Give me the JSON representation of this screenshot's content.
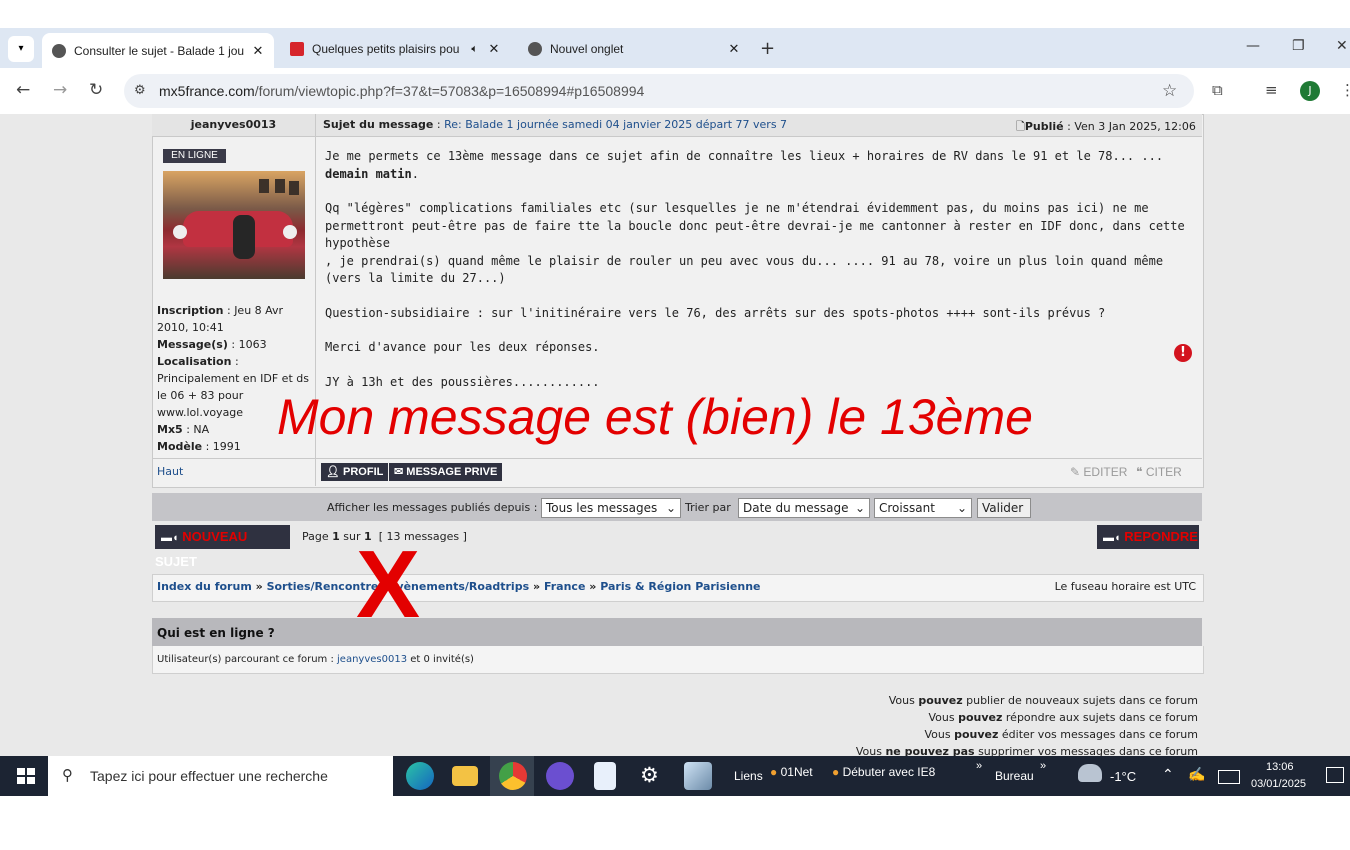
{
  "browser": {
    "tabs": [
      {
        "title": "Consulter le sujet - Balade 1 jou",
        "active": true
      },
      {
        "title": "Quelques petits plaisirs pou",
        "active": false
      },
      {
        "title": "Nouvel onglet",
        "active": false
      }
    ],
    "url_host": "mx5france.com",
    "url_path": "/forum/viewtopic.php?f=37&t=57083&p=16508994#p16508994",
    "profile_initial": "J"
  },
  "post": {
    "author": "jeanyves0013",
    "subject_label": "Sujet du message",
    "subject": "Re: Balade 1 journée samedi 04 janvier 2025 départ 77 vers 7",
    "published_label": "Publié",
    "published": "Ven 3 Jan 2025, 12:06",
    "online_badge": "EN LIGNE",
    "profile": [
      {
        "label": "Inscription",
        "value": "Jeu 8 Avr 2010, 10:41"
      },
      {
        "label": "Message(s)",
        "value": "1063"
      },
      {
        "label": "Localisation",
        "value": "Principalement en IDF et ds le 06 + 83 pour www.lol.voyage"
      },
      {
        "label": "Mx5",
        "value": "NA"
      },
      {
        "label": "Modèle",
        "value": "1991"
      }
    ],
    "body_lines": [
      "Je me permets ce 13ème message dans ce sujet afin de connaître les lieux + horaires de RV dans le 91 et le 78... ...",
      "demain matin",
      "Qq \"légères\" complications familiales etc (sur lesquelles je ne m'étendrai évidemment pas, du moins pas ici) ne me permettront peut-être pas de faire tte la boucle donc peut-être devrai-je me cantonner à rester en IDF donc, dans cette hypothèse",
      ", je prendrai(s) quand même le plaisir de rouler un peu avec vous du... .... 91 au 78, voire un plus loin quand même (vers la limite du 27...)",
      "Question-subsidiaire : sur l'initinéraire vers le 76, des arrêts sur des spots-photos ++++ sont-ils prévus ?",
      "Merci d'avance pour les deux réponses.",
      "JY à 13h et des poussières............"
    ],
    "top_link": "Haut",
    "btn_profile": "PROFIL",
    "btn_pm": "MESSAGE PRIVE",
    "btn_edit": "EDITER",
    "btn_quote": "CITER"
  },
  "annotation": {
    "overlay_text": "Mon message est (bien) le 13ème",
    "mark": "X"
  },
  "filters": {
    "label_since": "Afficher les messages publiés depuis :",
    "since_value": "Tous les messages",
    "label_sort": "Trier par",
    "sort_value": "Date du message",
    "order_value": "Croissant",
    "submit": "Valider"
  },
  "pagination": {
    "new_topic_prefix": "NOUVEAU",
    "new_topic_suffix": "SUJET",
    "reply": "REPONDRE",
    "page_text": "Page",
    "page_current": "1",
    "page_of": "sur",
    "page_total": "1",
    "count_text": "[ 13 messages ]"
  },
  "breadcrumb": {
    "items": [
      "Index du forum",
      "Sorties/Rencontres/Évènements/Roadtrips",
      "France",
      "Paris & Région Parisienne"
    ],
    "sep": "»",
    "timezone": "Le fuseau horaire est UTC"
  },
  "who_online": {
    "title": "Qui est en ligne ?",
    "prefix": "Utilisateur(s) parcourant ce forum :",
    "user": "jeanyves0013",
    "suffix": "et 0 invité(s)"
  },
  "permissions": [
    {
      "pre": "Vous",
      "bold": "pouvez",
      "post": "publier de nouveaux sujets dans ce forum"
    },
    {
      "pre": "Vous",
      "bold": "pouvez",
      "post": "répondre aux sujets dans ce forum"
    },
    {
      "pre": "Vous",
      "bold": "pouvez",
      "post": "éditer vos messages dans ce forum"
    },
    {
      "pre": "Vous",
      "bold": "ne pouvez pas",
      "post": "supprimer vos messages dans ce forum"
    }
  ],
  "taskbar": {
    "search_placeholder": "Tapez ici pour effectuer une recherche",
    "links_label": "Liens",
    "link1": "01Net",
    "link2": "Débuter avec IE8",
    "bureau": "Bureau",
    "weather": "-1°C",
    "time": "13:06",
    "date": "03/01/2025"
  },
  "colors": {
    "accent_red": "#e30000",
    "button_dark": "#2f3140",
    "link_blue": "#1e4f8c",
    "taskbar": "#1c2433"
  }
}
